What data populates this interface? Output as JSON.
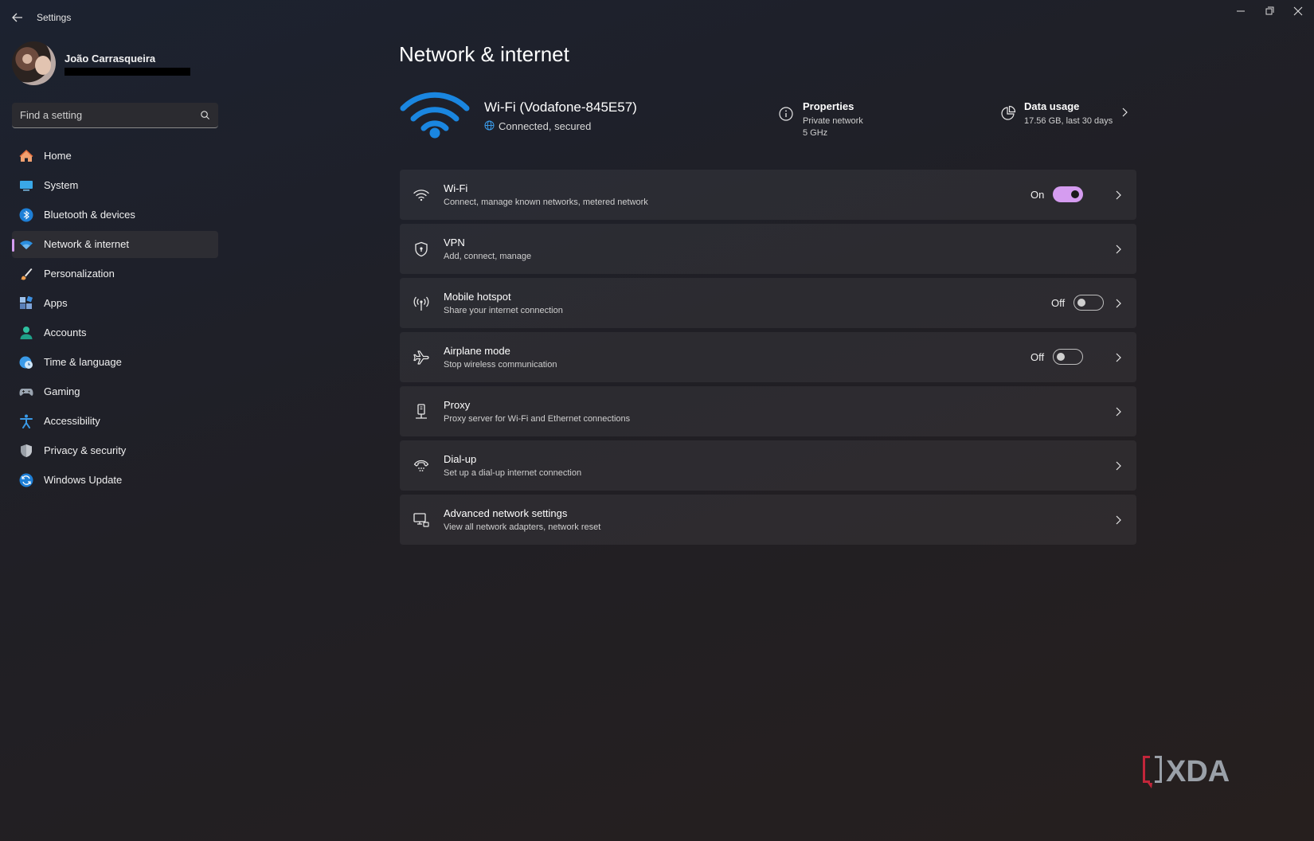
{
  "window": {
    "title": "Settings"
  },
  "profile": {
    "name": "João Carrasqueira"
  },
  "search": {
    "placeholder": "Find a setting"
  },
  "sidebar": {
    "items": [
      {
        "label": "Home",
        "icon": "home-icon"
      },
      {
        "label": "System",
        "icon": "monitor-icon"
      },
      {
        "label": "Bluetooth & devices",
        "icon": "bluetooth-icon"
      },
      {
        "label": "Network & internet",
        "icon": "wifi-icon",
        "active": true
      },
      {
        "label": "Personalization",
        "icon": "brush-icon"
      },
      {
        "label": "Apps",
        "icon": "apps-icon"
      },
      {
        "label": "Accounts",
        "icon": "person-icon"
      },
      {
        "label": "Time & language",
        "icon": "globe-clock-icon"
      },
      {
        "label": "Gaming",
        "icon": "gamepad-icon"
      },
      {
        "label": "Accessibility",
        "icon": "accessibility-icon"
      },
      {
        "label": "Privacy & security",
        "icon": "shield-icon"
      },
      {
        "label": "Windows Update",
        "icon": "update-icon"
      }
    ]
  },
  "main": {
    "title": "Network & internet",
    "connection": {
      "name": "Wi-Fi (Vodafone-845E57)",
      "status": "Connected, secured"
    },
    "properties": {
      "title": "Properties",
      "line1": "Private network",
      "line2": "5 GHz"
    },
    "data_usage": {
      "title": "Data usage",
      "subtitle": "17.56 GB, last 30 days"
    },
    "cards": [
      {
        "title": "Wi-Fi",
        "subtitle": "Connect, manage known networks, metered network",
        "toggle": "On"
      },
      {
        "title": "VPN",
        "subtitle": "Add, connect, manage"
      },
      {
        "title": "Mobile hotspot",
        "subtitle": "Share your internet connection",
        "toggle": "Off"
      },
      {
        "title": "Airplane mode",
        "subtitle": "Stop wireless communication",
        "toggle": "Off"
      },
      {
        "title": "Proxy",
        "subtitle": "Proxy server for Wi-Fi and Ethernet connections"
      },
      {
        "title": "Dial-up",
        "subtitle": "Set up a dial-up internet connection"
      },
      {
        "title": "Advanced network settings",
        "subtitle": "View all network adapters, network reset"
      }
    ]
  },
  "colors": {
    "accent": "#d59cf0",
    "wifi_blue": "#1a86e0"
  },
  "watermark": {
    "text": "XDA"
  }
}
